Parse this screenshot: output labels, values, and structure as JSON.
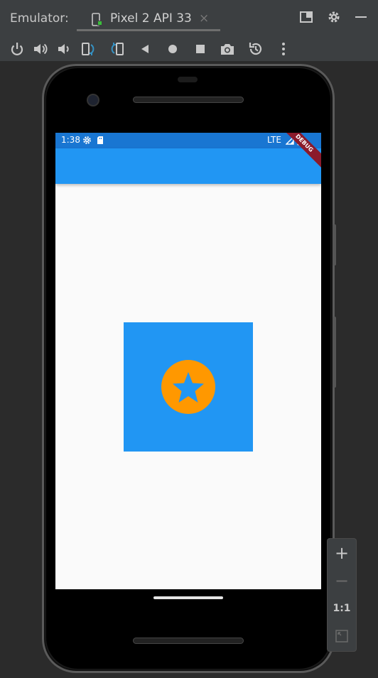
{
  "toolbar_header": {
    "emulator_label": "Emulator:",
    "device_tab": "Pixel 2 API 33",
    "close_glyph": "×"
  },
  "toolbar_icons": [
    "power-icon",
    "volume-up-icon",
    "volume-down-icon",
    "rotate-left-icon",
    "rotate-right-icon",
    "back-icon",
    "home-icon",
    "overview-icon",
    "screenshot-icon",
    "snapshot-icon",
    "more-icon"
  ],
  "status_bar": {
    "time": "1:38",
    "network": "LTE"
  },
  "debug_banner": "DEBUG",
  "zoom_controls": {
    "zoom_in": "+",
    "zoom_out": "−",
    "actual_size": "1:1"
  },
  "colors": {
    "status_bar": "#1976d2",
    "app_bar": "#2196f3",
    "box": "#2196f3",
    "star_circle": "#ff9800",
    "debug_banner": "#8b1a2b"
  }
}
